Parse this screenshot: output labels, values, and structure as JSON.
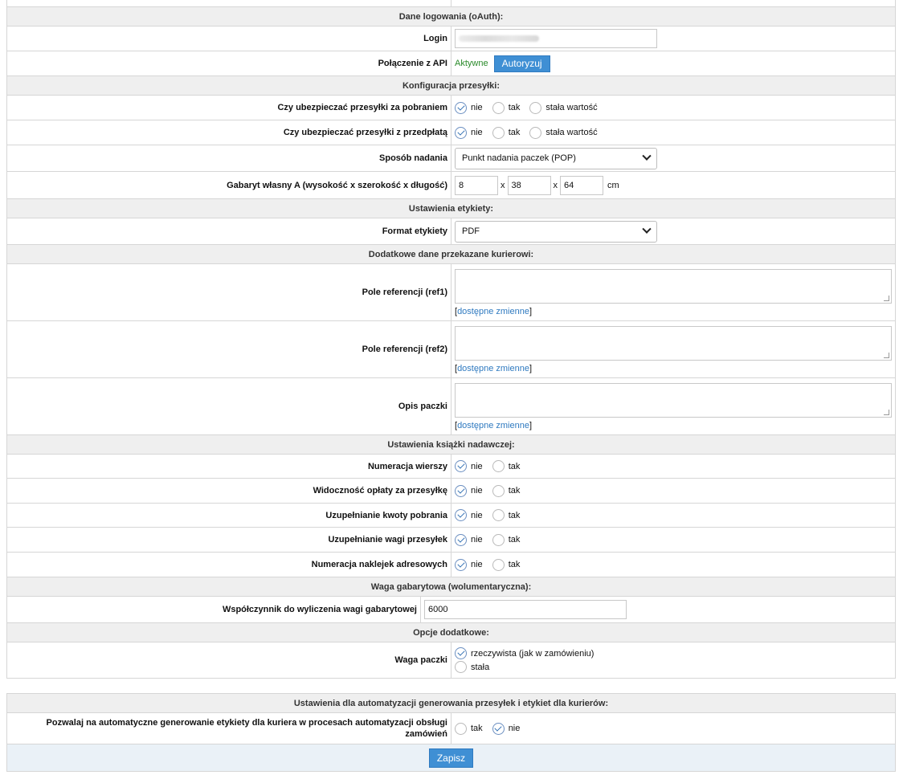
{
  "sections": {
    "login_header": "Dane logowania (oAuth):",
    "shipment_header": "Konfiguracja przesyłki:",
    "label_header": "Ustawienia etykiety:",
    "extra_header": "Dodatkowe dane przekazane kurierowi:",
    "book_header": "Ustawienia książki nadawczej:",
    "weight_header": "Waga gabarytowa (wolumentaryczna):",
    "options_header": "Opcje dodatkowe:",
    "automation_header": "Ustawienia dla automatyzacji generowania przesyłek i etykiet dla kurierów:"
  },
  "login": {
    "label": "Login",
    "value": ""
  },
  "api": {
    "label": "Połączenie z API",
    "status": "Aktywne",
    "button": "Autoryzuj",
    "status_color": "#2a8a2a"
  },
  "shipment": {
    "cod_label": "Czy ubezpieczać przesyłki za pobraniem",
    "prepaid_label": "Czy ubezpieczać przesyłki z przedpłatą",
    "opt_nie": "nie",
    "opt_tak": "tak",
    "opt_fixed": "stała wartość",
    "method_label": "Sposób nadania",
    "method_value": "Punkt nadania paczek (POP)",
    "dims_label": "Gabaryt własny A (wysokość x szerokość x długość)",
    "dim_h": "8",
    "dim_w": "38",
    "dim_l": "64",
    "dim_sep": "x",
    "dim_unit": "cm"
  },
  "label_format": {
    "label": "Format etykiety",
    "value": "PDF"
  },
  "extra": {
    "ref1_label": "Pole referencji (ref1)",
    "ref2_label": "Pole referencji (ref2)",
    "desc_label": "Opis paczki",
    "vars_link": "dostępne zmienne",
    "bracket_open": "[",
    "bracket_close": "]"
  },
  "book": {
    "row_numbering": "Numeracja wierszy",
    "fee_visibility": "Widoczność opłaty za przesyłkę",
    "cod_amount": "Uzupełnianie kwoty pobrania",
    "weight_fill": "Uzupełnianie wagi przesyłek",
    "sticker_numbering": "Numeracja naklejek adresowych"
  },
  "weight": {
    "label": "Współczynnik do wyliczenia wagi gabarytowej",
    "value": "6000"
  },
  "options": {
    "label": "Waga paczki",
    "real": "rzeczywista (jak w zamówieniu)",
    "fixed": "stała"
  },
  "automation": {
    "label": "Pozwalaj na automatyczne generowanie etykiety dla kuriera w procesach automatyzacji obsługi zamówień",
    "opt_tak": "tak",
    "opt_nie": "nie",
    "save": "Zapisz"
  },
  "colors": {
    "accent": "#3f8fd4",
    "header_bg": "#efefef",
    "link": "#2f7ac0"
  }
}
